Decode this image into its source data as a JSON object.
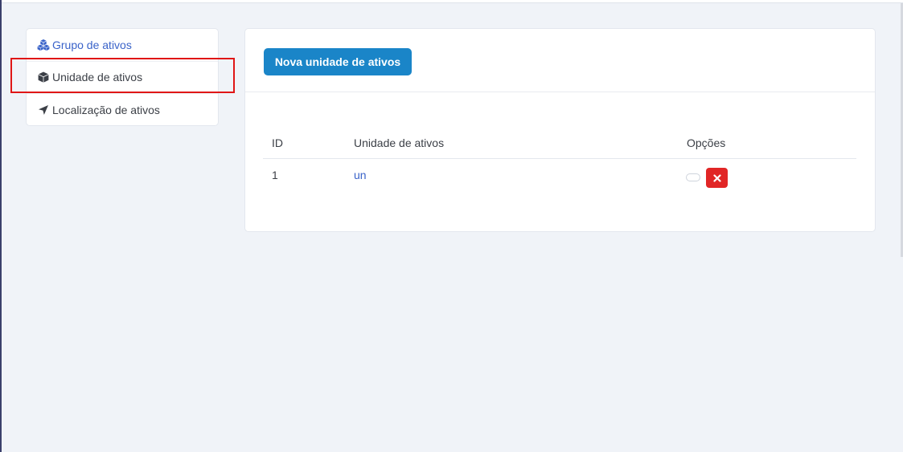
{
  "sidebar": {
    "items": [
      {
        "label": "Grupo de ativos",
        "icon": "cubes-icon",
        "active": true
      },
      {
        "label": "Unidade de ativos",
        "icon": "cube-icon",
        "active": false
      },
      {
        "label": "Localização de ativos",
        "icon": "location-arrow-icon",
        "active": false
      }
    ]
  },
  "main": {
    "new_button_label": "Nova unidade de ativos",
    "table": {
      "columns": [
        "ID",
        "Unidade de ativos",
        "Opções"
      ],
      "rows": [
        {
          "id": "1",
          "unit": "un"
        }
      ]
    }
  },
  "colors": {
    "accent": "#1a85c8",
    "link": "#3a63c9",
    "danger": "#e12626",
    "highlight": "#e01616",
    "background": "#f0f3f8"
  }
}
